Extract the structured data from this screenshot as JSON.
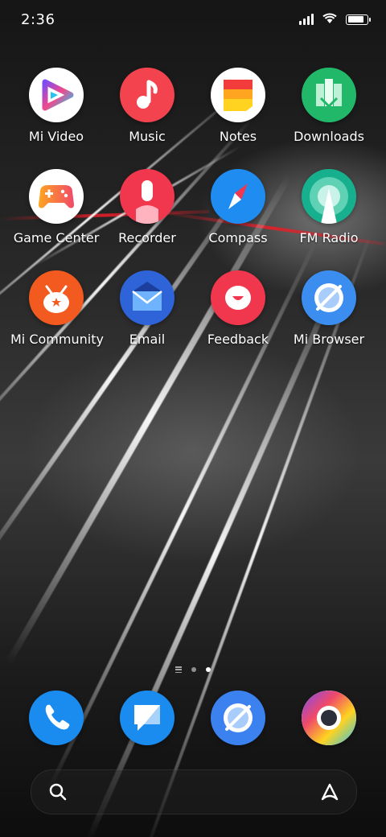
{
  "status_bar": {
    "time": "2:36",
    "icons": [
      "cellular-signal-icon",
      "wifi-icon",
      "battery-icon"
    ],
    "battery_fill": 0.85
  },
  "home_apps": [
    {
      "label": "Mi Video",
      "icon": "mi-video-icon",
      "color": "#ffffff"
    },
    {
      "label": "Music",
      "icon": "music-icon",
      "color": "#f2434f"
    },
    {
      "label": "Notes",
      "icon": "notes-icon",
      "color": "#ffffff"
    },
    {
      "label": "Downloads",
      "icon": "downloads-icon",
      "color": "#22b86a"
    },
    {
      "label": "Game Center",
      "icon": "game-center-icon",
      "color": "#ffffff"
    },
    {
      "label": "Recorder",
      "icon": "recorder-icon",
      "color": "#f0374d"
    },
    {
      "label": "Compass",
      "icon": "compass-icon",
      "color": "#1e8cf0"
    },
    {
      "label": "FM Radio",
      "icon": "fm-radio-icon",
      "color": "#17b08e"
    },
    {
      "label": "Mi Community",
      "icon": "mi-community-icon",
      "color": "#f25a20"
    },
    {
      "label": "Email",
      "icon": "email-icon",
      "color": "#2f63d8"
    },
    {
      "label": "Feedback",
      "icon": "feedback-icon",
      "color": "#f0374d"
    },
    {
      "label": "Mi Browser",
      "icon": "mi-browser-icon",
      "color": "#3b8ef0"
    }
  ],
  "page_indicator": {
    "total_pages": 2,
    "current_page": 2
  },
  "dock": [
    {
      "icon": "phone-icon",
      "color": "#1a8cf0"
    },
    {
      "icon": "messages-icon",
      "color": "#1a8cf0"
    },
    {
      "icon": "browser-icon",
      "color": "#3b82f0"
    },
    {
      "icon": "chrome-icon",
      "color": "#ffffff"
    }
  ],
  "search_bar": {
    "left_icon": "search-icon",
    "right_icon": "app-vault-icon"
  }
}
